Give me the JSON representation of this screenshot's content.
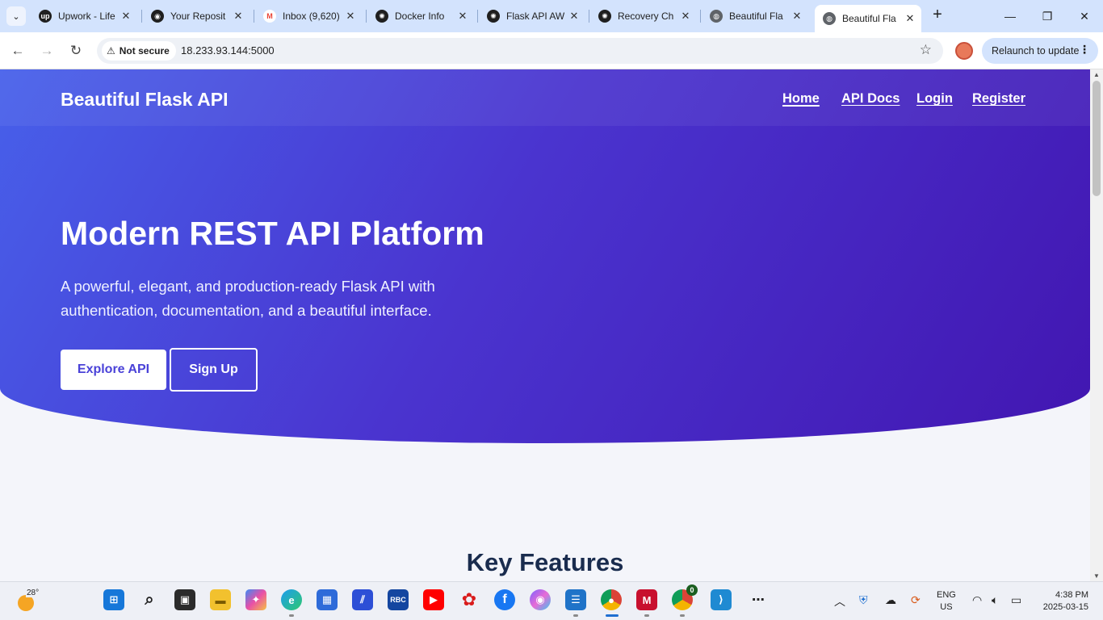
{
  "browser": {
    "tabs": [
      {
        "title": "Upwork - Life",
        "icon": "upwork-icon",
        "color": "#1f1f1f",
        "glyph": "up"
      },
      {
        "title": "Your Reposit",
        "icon": "github-icon",
        "color": "#1f1f1f",
        "glyph": "◉"
      },
      {
        "title": "Inbox (9,620)",
        "icon": "gmail-icon",
        "color": "#ea4335",
        "glyph": "M"
      },
      {
        "title": "Docker Info",
        "icon": "chatgpt-icon",
        "color": "#1f1f1f",
        "glyph": "✺"
      },
      {
        "title": "Flask API AW",
        "icon": "chatgpt-icon",
        "color": "#1f1f1f",
        "glyph": "✺"
      },
      {
        "title": "Recovery Ch",
        "icon": "chatgpt-icon",
        "color": "#1f1f1f",
        "glyph": "✺"
      },
      {
        "title": "Beautiful Fla",
        "icon": "globe-icon",
        "color": "#5f6368",
        "glyph": "◍"
      },
      {
        "title": "Beautiful Fla",
        "icon": "globe-icon",
        "color": "#5f6368",
        "glyph": "◍",
        "active": true
      }
    ],
    "security_label": "Not secure",
    "url": "18.233.93.144:5000",
    "relaunch_label": "Relaunch to update"
  },
  "site": {
    "brand": "Beautiful Flask API",
    "nav": [
      "Home",
      "API Docs",
      "Login",
      "Register"
    ],
    "hero": {
      "title": "Modern REST API Platform",
      "text": "A powerful, elegant, and production-ready Flask API with authentication, documentation, and a beautiful interface.",
      "primary_button": "Explore API",
      "secondary_button": "Sign Up"
    },
    "features_title": "Key Features"
  },
  "taskbar": {
    "temperature": "28°",
    "language": "ENG",
    "region": "US",
    "time": "4:38 PM",
    "date": "2025-03-15",
    "badge": "0"
  },
  "colors": {
    "hero_start": "#4760ea",
    "hero_end": "#4216b1",
    "primary_button_text": "#4a42d8",
    "heading_dark": "#1a2c4e"
  }
}
